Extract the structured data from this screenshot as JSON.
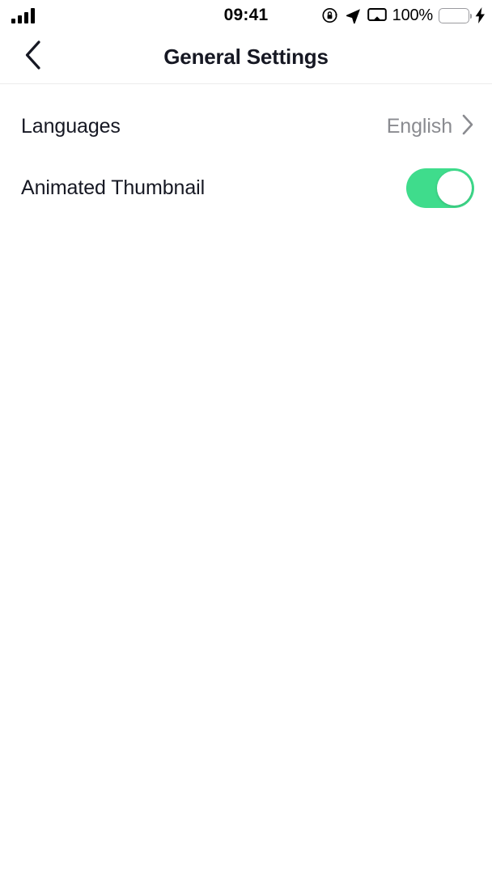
{
  "status_bar": {
    "signal_icon": "cellular-signal-icon",
    "signal_bars": 4,
    "time": "09:41",
    "rotation_lock_icon": "rotation-lock-icon",
    "location_icon": "location-arrow-icon",
    "airplay_icon": "screen-mirroring-icon",
    "battery_percent": "100%",
    "battery_level": 100,
    "battery_fill_color": "#37e07a",
    "charging_icon": "lightning-bolt-icon"
  },
  "header": {
    "back_icon": "chevron-left-icon",
    "title": "General Settings"
  },
  "settings": {
    "rows": [
      {
        "label": "Languages",
        "value": "English",
        "control": "disclosure",
        "chevron_icon": "chevron-right-icon",
        "name": "languages"
      },
      {
        "label": "Animated Thumbnail",
        "value": "",
        "control": "toggle",
        "toggle_on": true,
        "name": "animated-thumbnail"
      }
    ]
  },
  "colors": {
    "accent_green": "#3fdc8c",
    "text_primary": "#161823",
    "text_secondary": "#8a8b90",
    "divider": "#ececec",
    "background": "#ffffff"
  }
}
